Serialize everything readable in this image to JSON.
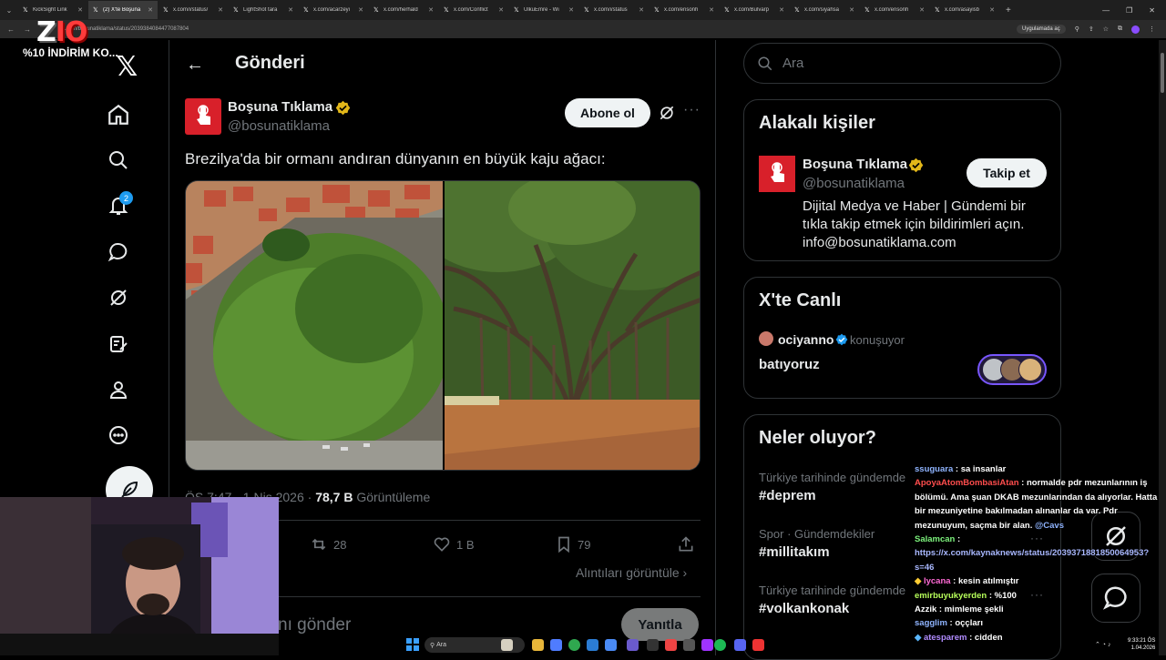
{
  "browser": {
    "tabs": [
      {
        "label": "KickSight Link",
        "active": false
      },
      {
        "label": "(2) X'te Boşuna",
        "active": true
      },
      {
        "label": "x.com/i/status/",
        "active": false
      },
      {
        "label": "LightShot tara",
        "active": false
      },
      {
        "label": "x.com/acarzeyi",
        "active": false
      },
      {
        "label": "x.com/herhald",
        "active": false
      },
      {
        "label": "x.com/Conflict",
        "active": false
      },
      {
        "label": "UlkuEmre - Wi",
        "active": false
      },
      {
        "label": "x.com/i/status",
        "active": false
      },
      {
        "label": "x.com/ensonh",
        "active": false
      },
      {
        "label": "x.com/Bulvarp",
        "active": false
      },
      {
        "label": "x.com/siyahsa",
        "active": false
      },
      {
        "label": "x.com/ensonh",
        "active": false
      },
      {
        "label": "x.com/asayisb",
        "active": false
      }
    ],
    "url": "x.com/bosunatiklama/status/2039384084477087804",
    "translate_chip": "Uygulamada aç"
  },
  "overlay": {
    "logo_a": "Z",
    "logo_b": "IO",
    "discount": "%10 İNDİRİM KO..."
  },
  "left_nav": {
    "items": [
      {
        "name": "home-icon",
        "glyph": "⌂"
      },
      {
        "name": "search-icon",
        "glyph": "⚲"
      },
      {
        "name": "notifications-icon",
        "glyph": ""
      },
      {
        "name": "messages-icon",
        "glyph": ""
      },
      {
        "name": "grok-icon",
        "glyph": ""
      },
      {
        "name": "compose-list-icon",
        "glyph": ""
      },
      {
        "name": "profile-icon",
        "glyph": ""
      },
      {
        "name": "more-icon",
        "glyph": ""
      }
    ],
    "notif_count": "2"
  },
  "post": {
    "header_title": "Gönderi",
    "author_name": "Boşuna Tıklama",
    "author_handle": "@bosunatiklama",
    "subscribe_label": "Abone ol",
    "text": "Brezilya'da bir ormanı andıran dünyanın en büyük kaju ağacı:",
    "timestamp": "ÖS 7:47 · 1 Nis 2026 · ",
    "views_value": "78,7 B",
    "views_label": " Görüntüleme",
    "retweets": "28",
    "likes": "1 B",
    "bookmarks": "79",
    "quotes_link": "Alıntıları görüntüle",
    "reply_placeholder": "nı gönder",
    "reply_button": "Yanıtla"
  },
  "right": {
    "search_placeholder": "Ara",
    "related": {
      "title": "Alakalı kişiler",
      "name": "Boşuna Tıklama",
      "handle": "@bosunatiklama",
      "follow_label": "Takip et",
      "bio": "Dijital Medya ve Haber | Gündemi bir tıkla takip etmek için bildirimleri açın. info@bosunatiklama.com"
    },
    "live": {
      "title": "X'te Canlı",
      "host": "ociyanno",
      "status": "konuşuyor",
      "topic": "batıyoruz"
    },
    "trends": {
      "title": "Neler oluyor?",
      "items": [
        {
          "meta": "Türkiye tarihinde gündemde",
          "tag": "#deprem"
        },
        {
          "meta": "Spor · Gündemdekiler",
          "tag": "#millitakım"
        },
        {
          "meta": "Türkiye tarihinde gündemde",
          "tag": "#volkankonak"
        }
      ]
    }
  },
  "chat": [
    {
      "user": "ssuguara",
      "color": "#8fb4ff",
      "text": " : sa insanlar"
    },
    {
      "user": "ApoyaAtomBombasiAtan",
      "color": "#ff4d4d",
      "text": " : normalde pdr mezunlarının iş bölümü. Ama şuan DKAB mezunlarından da alıyorlar. Hatta bir mezuniyetine bakılmadan alınanlar da var. Pdr mezunuyum, saçma bir alan. ",
      "mention": "@Cavs"
    },
    {
      "user": "Salamcan",
      "color": "#7cf27c",
      "text": " : ",
      "link": "https://x.com/kaynaknews/status/2039371881850064953?s=46"
    },
    {
      "user": "lycana",
      "color": "#ff6ad5",
      "text": " : kesin atılmıştır"
    },
    {
      "user": "emirbuyukyerden",
      "color": "#b7ff5a",
      "text": " : %100"
    },
    {
      "user": "Azzik",
      "color": "#ffffff",
      "text": " : mimleme şekli"
    },
    {
      "user": "sagglim",
      "color": "#8fb4ff",
      "text": " : oççları"
    },
    {
      "user": "atesparem",
      "color": "#b18cff",
      "text": " : cidden"
    }
  ],
  "taskbar": {
    "search_placeholder": "Ara",
    "time": "9:33:21 ÖS",
    "date": "1.04.2026"
  }
}
